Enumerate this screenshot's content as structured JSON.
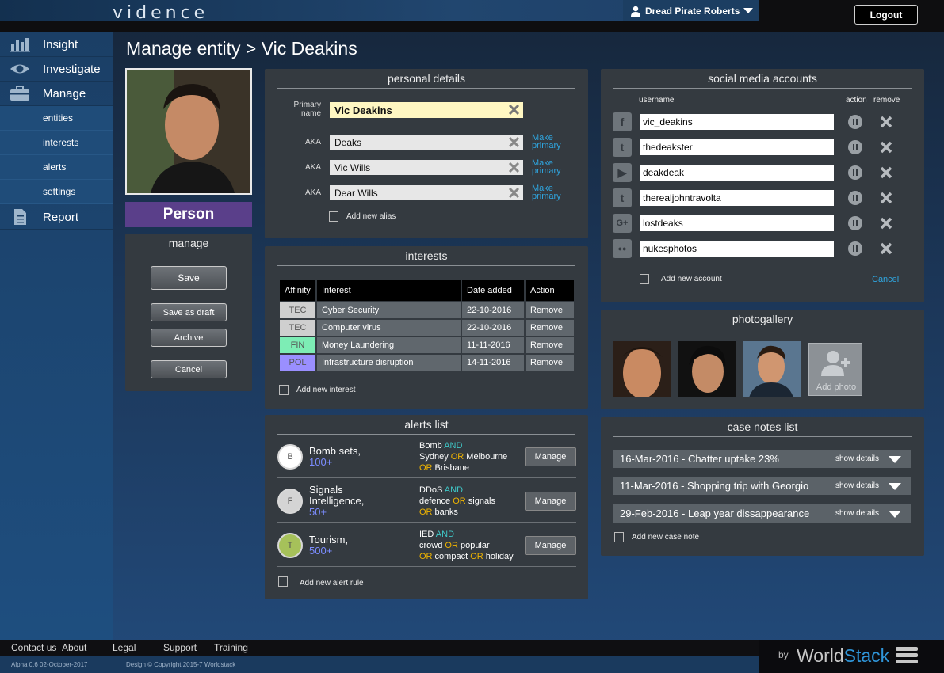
{
  "app": {
    "logo": "vidence"
  },
  "header": {
    "user_name": "Dread Pirate Roberts",
    "logout_label": "Logout"
  },
  "sidebar": {
    "main": [
      {
        "label": "Insight",
        "icon": "bar-chart-icon"
      },
      {
        "label": "Investigate",
        "icon": "eye-icon"
      },
      {
        "label": "Manage",
        "icon": "briefcase-icon"
      },
      {
        "label": "Report",
        "icon": "document-icon"
      }
    ],
    "sub": [
      {
        "label": "entities"
      },
      {
        "label": "interests"
      },
      {
        "label": "alerts"
      },
      {
        "label": "settings"
      }
    ]
  },
  "page": {
    "title": "Manage entity > Vic Deakins"
  },
  "entity": {
    "type_label": "Person"
  },
  "manage": {
    "title": "manage",
    "save": "Save",
    "save_draft": "Save as draft",
    "archive": "Archive",
    "cancel": "Cancel"
  },
  "personal": {
    "title": "personal details",
    "primary_label": "Primary name",
    "primary_value": "Vic Deakins",
    "aka_label": "AKA",
    "make_primary": "Make primary",
    "aliases": [
      "Deaks",
      "Vic Wills",
      "Dear Wills"
    ],
    "add_alias": "Add new alias"
  },
  "interests": {
    "title": "interests",
    "headers": [
      "Affinity",
      "Interest",
      "Date added",
      "Action"
    ],
    "rows": [
      {
        "affinity": "TEC",
        "affinity_color": "#cfcfcf",
        "interest": "Cyber Security",
        "date": "22-10-2016",
        "action": "Remove"
      },
      {
        "affinity": "TEC",
        "affinity_color": "#cfcfcf",
        "interest": "Computer virus",
        "date": "22-10-2016",
        "action": "Remove"
      },
      {
        "affinity": "FIN",
        "affinity_color": "#7dedb5",
        "interest": "Money Laundering",
        "date": "11-11-2016",
        "action": "Remove"
      },
      {
        "affinity": "POL",
        "affinity_color": "#9a8fff",
        "interest": "Infrastructure disruption",
        "date": "14-11-2016",
        "action": "Remove"
      }
    ],
    "add_label": "Add new interest"
  },
  "alerts": {
    "title": "alerts list",
    "manage_label": "Manage",
    "add_label": "Add new alert rule",
    "rows": [
      {
        "letter": "B",
        "circle_color": "#ffffff",
        "name": "Bomb sets,",
        "count": "100+",
        "rule": [
          [
            {
              "t": "Bomb ",
              "k": ""
            },
            {
              "t": "AND",
              "k": "and"
            }
          ],
          [
            {
              "t": "Sydney ",
              "k": ""
            },
            {
              "t": "OR",
              "k": "or"
            },
            {
              "t": " Melbourne",
              "k": ""
            }
          ],
          [
            {
              "t": "OR",
              "k": "or"
            },
            {
              "t": " Brisbane",
              "k": ""
            }
          ]
        ]
      },
      {
        "letter": "F",
        "circle_color": "#d4d4d4",
        "name": "Signals Intelligence,",
        "count": "50+",
        "rule": [
          [
            {
              "t": "DDoS ",
              "k": ""
            },
            {
              "t": "AND",
              "k": "and"
            }
          ],
          [
            {
              "t": "defence ",
              "k": ""
            },
            {
              "t": "OR",
              "k": "or"
            },
            {
              "t": " signals",
              "k": ""
            }
          ],
          [
            {
              "t": "OR",
              "k": "or"
            },
            {
              "t": " banks",
              "k": ""
            }
          ]
        ]
      },
      {
        "letter": "T",
        "circle_color": "#a6c15a",
        "name": "Tourism,",
        "count": "500+",
        "rule": [
          [
            {
              "t": "IED ",
              "k": ""
            },
            {
              "t": "AND",
              "k": "and"
            }
          ],
          [
            {
              "t": "crowd ",
              "k": ""
            },
            {
              "t": "OR",
              "k": "or"
            },
            {
              "t": " popular",
              "k": ""
            }
          ],
          [
            {
              "t": "OR",
              "k": "or"
            },
            {
              "t": " compact ",
              "k": ""
            },
            {
              "t": "OR",
              "k": "or"
            },
            {
              "t": " holiday",
              "k": ""
            }
          ]
        ]
      }
    ]
  },
  "social": {
    "title": "social media accounts",
    "col_username": "username",
    "col_action": "action",
    "col_remove": "remove",
    "accounts": [
      {
        "icon": "facebook-icon",
        "glyph": "f",
        "username": "vic_deakins"
      },
      {
        "icon": "twitter-icon",
        "glyph": "t",
        "username": "thedeakster"
      },
      {
        "icon": "youtube-icon",
        "glyph": "▶",
        "username": "deakdeak"
      },
      {
        "icon": "tumblr-icon",
        "glyph": "t",
        "username": "therealjohntravolta"
      },
      {
        "icon": "google-plus-icon",
        "glyph": "G+",
        "username": "lostdeaks"
      },
      {
        "icon": "flickr-icon",
        "glyph": "●●",
        "username": "nukesphotos"
      }
    ],
    "add_label": "Add new account",
    "cancel_label": "Cancel"
  },
  "gallery": {
    "title": "photogallery",
    "add_label": "Add photo"
  },
  "case_notes": {
    "title": "case notes list",
    "show_details": "show details",
    "notes": [
      "16-Mar-2016 - Chatter uptake 23%",
      "11-Mar-2016 - Shopping trip with Georgio",
      "29-Feb-2016 - Leap year dissappearance"
    ],
    "add_label": "Add new case note"
  },
  "footer": {
    "links": [
      "Contact us",
      "About",
      "Legal",
      "Support",
      "Training"
    ],
    "version": "Alpha 0.6 02-October-2017",
    "copyright": "Design © Copyright 2015-7 Worldstack",
    "by": "by",
    "brand_world": "World",
    "brand_stack": "Stack"
  },
  "colors": {
    "accent": "#2fa6e0",
    "person_badge": "#5a3f8a",
    "and_keyword": "#3fc8c8",
    "or_keyword": "#f0b400",
    "alert_count": "#7b8cff"
  }
}
